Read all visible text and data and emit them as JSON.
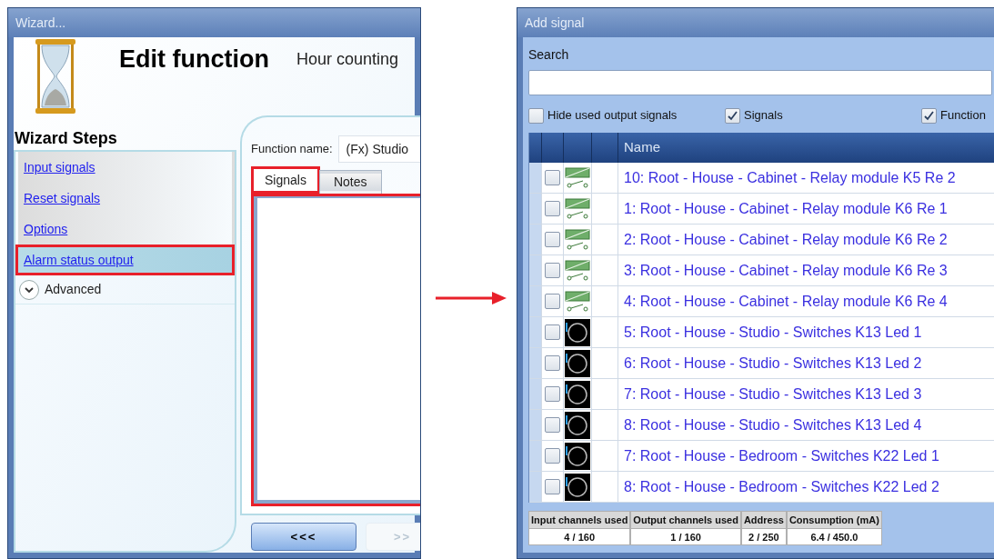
{
  "wizard": {
    "title": "Wizard...",
    "heading": "Edit function",
    "subtitle": "Hour counting",
    "steps_heading": "Wizard Steps",
    "steps": [
      {
        "label": "Input signals",
        "selected": false,
        "highlighted": false
      },
      {
        "label": "Reset signals",
        "selected": false,
        "highlighted": false
      },
      {
        "label": "Options",
        "selected": false,
        "highlighted": false
      },
      {
        "label": "Alarm status output",
        "selected": true,
        "highlighted": true
      }
    ],
    "advanced": {
      "label": "Advanced",
      "expanded": false
    },
    "function_name_label": "Function name:",
    "function_name": "(Fx) Studio",
    "tabs": [
      {
        "label": "Signals",
        "selected": true,
        "highlighted": true
      },
      {
        "label": "Notes",
        "selected": false,
        "highlighted": false
      }
    ],
    "tab_content_highlighted": true,
    "buttons": [
      {
        "label": "<<<",
        "disabled": false
      },
      {
        "label": ">>",
        "disabled": true
      }
    ]
  },
  "add_signal": {
    "title": "Add signal",
    "search_label": "Search",
    "filters": [
      {
        "label": "Hide used output signals",
        "checked": false
      },
      {
        "label": "Signals",
        "checked": true
      },
      {
        "label": "Function",
        "checked": true
      }
    ],
    "column_header": "Name",
    "rows": [
      {
        "kind": "relay",
        "name": "10: Root - House - Cabinet - Relay module K5 Re 2",
        "checked": false
      },
      {
        "kind": "relay",
        "name": "1: Root - House - Cabinet - Relay module K6 Re 1",
        "checked": false
      },
      {
        "kind": "relay",
        "name": "2: Root - House - Cabinet - Relay module K6 Re 2",
        "checked": false
      },
      {
        "kind": "relay",
        "name": "3: Root - House - Cabinet - Relay module K6 Re 3",
        "checked": false
      },
      {
        "kind": "relay",
        "name": "4: Root - House - Cabinet - Relay module K6 Re 4",
        "checked": false
      },
      {
        "kind": "led",
        "name": "5: Root - House - Studio - Switches K13 Led 1",
        "checked": false
      },
      {
        "kind": "led",
        "name": "6: Root - House - Studio - Switches K13 Led 2",
        "checked": false
      },
      {
        "kind": "led",
        "name": "7: Root - House - Studio - Switches K13 Led 3",
        "checked": false
      },
      {
        "kind": "led",
        "name": "8: Root - House - Studio - Switches K13 Led 4",
        "checked": false
      },
      {
        "kind": "led",
        "name": "7: Root - House - Bedroom - Switches K22 Led 1",
        "checked": false
      },
      {
        "kind": "led",
        "name": "8: Root - House - Bedroom - Switches K22 Led 2",
        "checked": false
      }
    ],
    "stats": [
      {
        "label": "Input channels used",
        "value": "4 / 160"
      },
      {
        "label": "Output channels used",
        "value": "1 / 160"
      },
      {
        "label": "Address",
        "value": "2 / 250"
      },
      {
        "label": "Consumption (mA)",
        "value": "6.4 / 450.0"
      }
    ]
  }
}
